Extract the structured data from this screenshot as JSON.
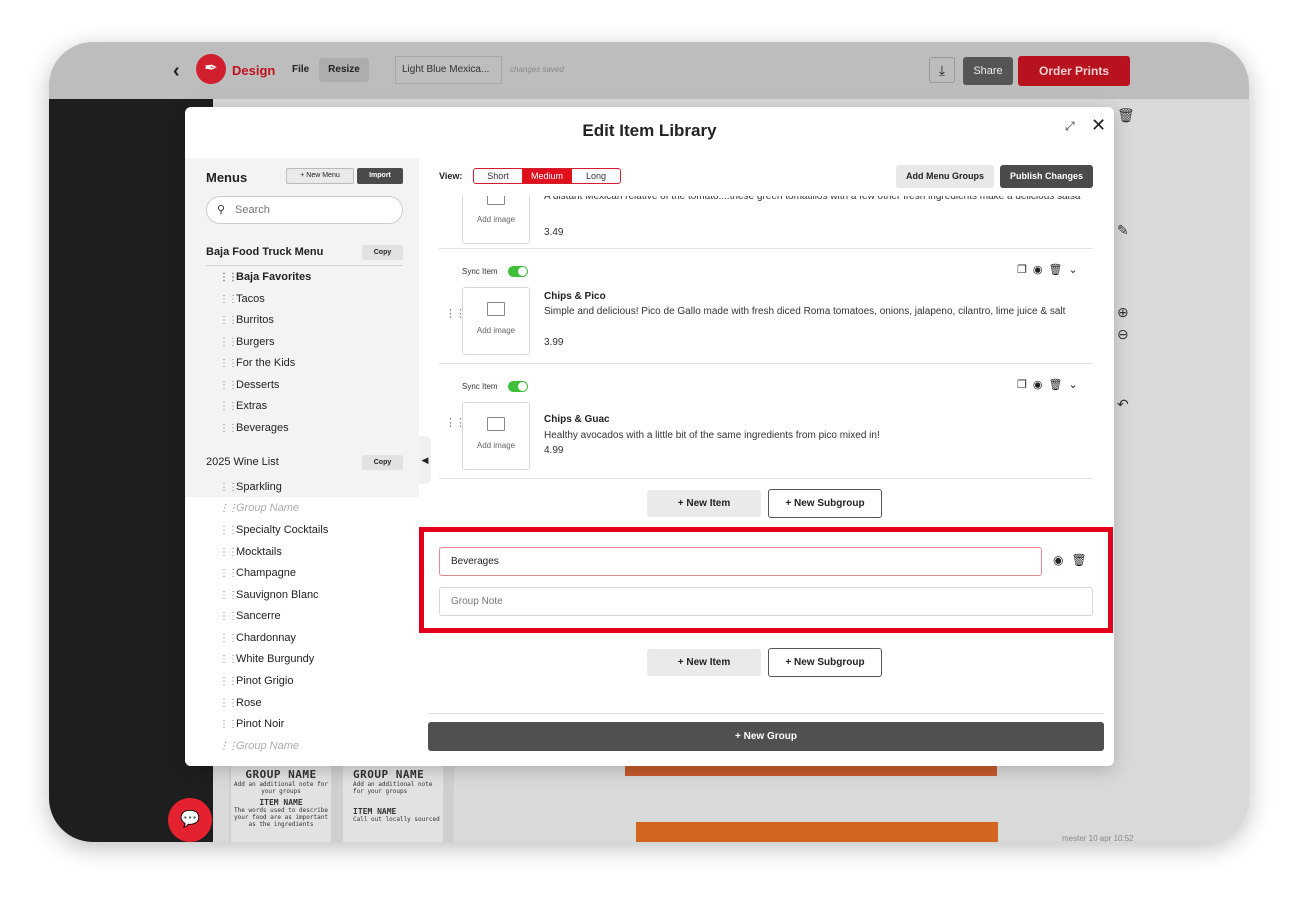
{
  "topbar": {
    "brand": "Design",
    "file": "File",
    "resize": "Resize",
    "doc_name": "Light Blue Mexica...",
    "saved_status": "changes saved",
    "share": "Share",
    "order_prints": "Order Prints"
  },
  "background": {
    "card1_title": "GROUP NAME",
    "card1_note": "Add an additional note for your groups",
    "card1_item": "ITEM NAME",
    "card1_desc": "The words used to describe your food are as important as the ingredients",
    "card2_title": "GROUP NAME",
    "card2_note": "Add an additional note for your groups",
    "card2_item": "ITEM NAME",
    "card2_desc": "Call out locally sourced",
    "timestamp": "mester 10 apr 10:52"
  },
  "modal": {
    "title": "Edit Item Library"
  },
  "sidebar": {
    "title": "Menus",
    "new_menu": "+ New Menu",
    "import": "Import",
    "search_placeholder": "Search",
    "copy": "Copy",
    "menus": [
      {
        "name": "Baja Food Truck Menu",
        "groups": [
          "Baja Favorites",
          "Tacos",
          "Burritos",
          "Burgers",
          "For the Kids",
          "Desserts",
          "Extras",
          "Beverages"
        ]
      },
      {
        "name": "2025 Wine List",
        "groups": [
          "Sparkling",
          "Group Name",
          "Specialty Cocktails",
          "Mocktails",
          "Champagne",
          "Sauvignon Blanc",
          "Sancerre",
          "Chardonnay",
          "White Burgundy",
          "Pinot Grigio",
          "Rose",
          "Pinot Noir",
          "Group Name"
        ]
      }
    ]
  },
  "main": {
    "view_label": "View:",
    "view_options": [
      "Short",
      "Medium",
      "Long"
    ],
    "view_selected": "Medium",
    "add_menu_groups": "Add Menu Groups",
    "publish_changes": "Publish Changes",
    "sync_label": "Sync Item",
    "add_image": "Add image",
    "items": [
      {
        "name": "",
        "description": "A distant Mexican relative of the tomato....these green tomatillos with a few other fresh ingredients make a delicious salsa",
        "price": "3.49"
      },
      {
        "name": "Chips & Pico",
        "description": "Simple and delicious! Pico de Gallo made with fresh diced Roma tomatoes, onions, jalapeno, cilantro, lime juice & salt",
        "price": "3.99"
      },
      {
        "name": "Chips & Guac",
        "description": "Healthy avocados with a little bit of the same ingredients from pico mixed in!",
        "price": "4.99"
      }
    ],
    "new_item": "+ New Item",
    "new_subgroup": "+ New Subgroup",
    "group_name_value": "Beverages",
    "group_note_placeholder": "Group Note",
    "new_group": "+ New Group"
  },
  "colors": {
    "accent": "#e0101e",
    "highlight": "#e3001b",
    "toggle_on": "#3fbf3a"
  }
}
